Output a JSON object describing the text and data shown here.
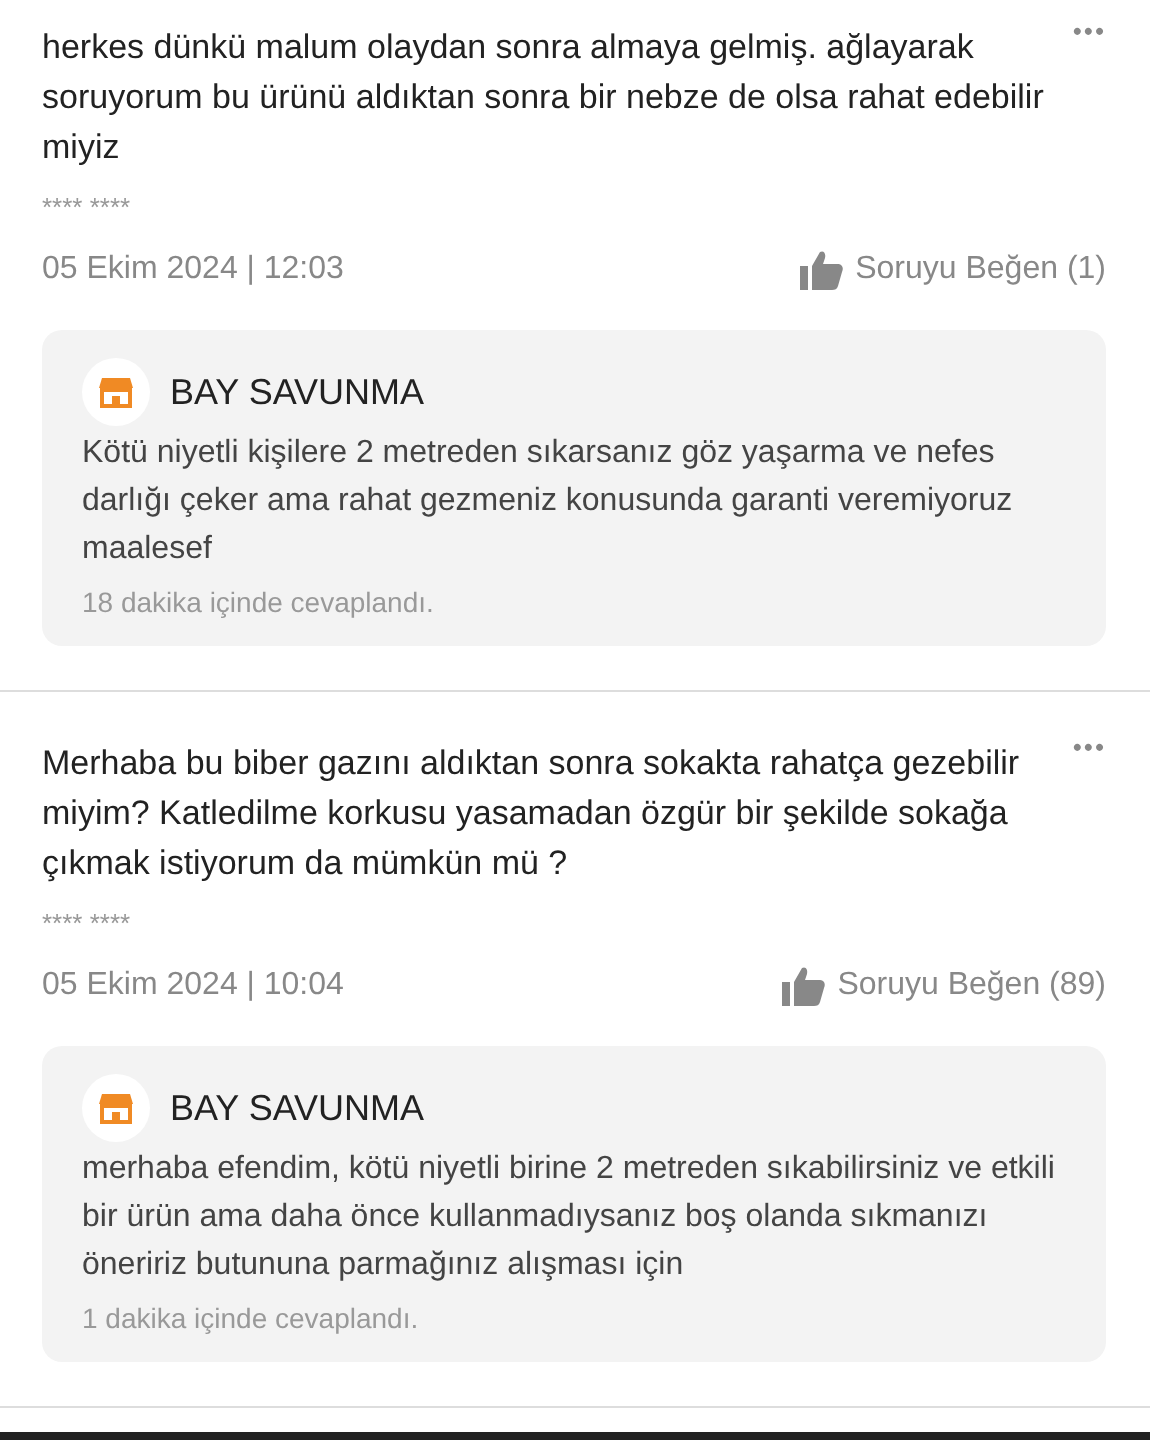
{
  "questions": [
    {
      "text": "herkes dünkü malum olaydan sonra almaya gelmiş. ağlayarak soruyorum bu ürünü aldıktan sonra bir nebze de olsa rahat edebilir miyiz",
      "more": "•••",
      "author": "**** ****",
      "date": "05 Ekim 2024 | 12:03",
      "like": "Soruyu Beğen (1)",
      "answer": {
        "seller": "BAY SAVUNMA",
        "text": "Kötü niyetli kişilere 2 metreden sıkarsanız göz yaşarma ve nefes darlığı çeker ama rahat gezmeniz konusunda garanti veremiyoruz maalesef",
        "time": "18 dakika içinde cevaplandı."
      }
    },
    {
      "text": "Merhaba bu biber gazını aldıktan sonra sokakta rahatça gezebilir miyim? Katledilme korkusu yasamadan özgür bir şekilde sokağa çıkmak istiyorum da mümkün mü ?",
      "more": "•••",
      "author": "**** ****",
      "date": "05 Ekim 2024 | 10:04",
      "like": "Soruyu Beğen (89)",
      "answer": {
        "seller": "BAY SAVUNMA",
        "text": "merhaba efendim, kötü niyetli birine 2 metreden sıkabilirsiniz ve etkili bir ürün ama daha önce kullanmadıysanız boş olanda sıkmanızı öneririz butununa parmağınız alışması için",
        "time": "1 dakika içinde cevaplandı."
      }
    }
  ]
}
